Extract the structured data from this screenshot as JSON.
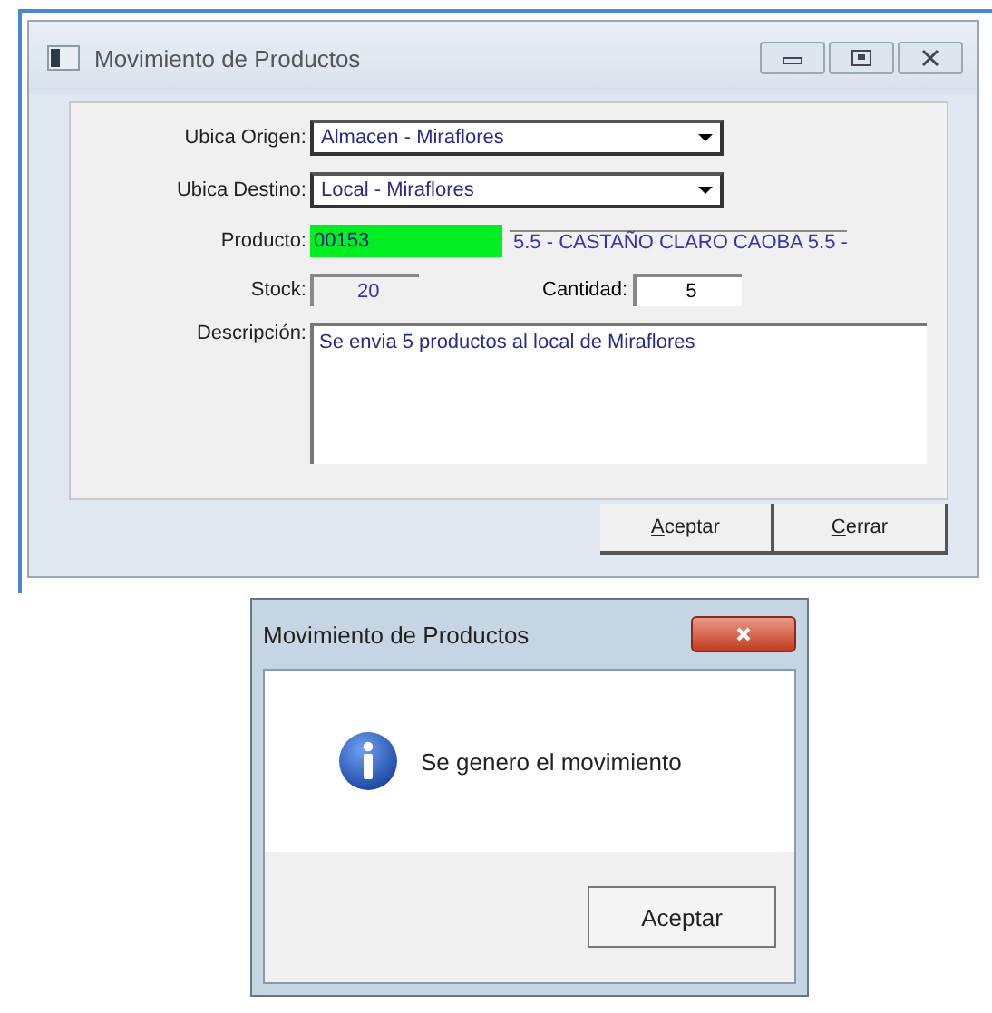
{
  "main_window": {
    "title": "Movimiento de Productos",
    "fields": [
      {
        "kind": "combo",
        "label": "Ubica Origen:",
        "value": "Almacen - Miraflores"
      },
      {
        "kind": "combo",
        "label": "Ubica Destino:",
        "value": "Local - Miraflores"
      },
      {
        "kind": "product",
        "label": "Producto:",
        "value": "00153",
        "description": "5.5 - CASTAÑO CLARO CAOBA 5.5 -"
      },
      {
        "kind": "pair",
        "label": "Stock:",
        "value": "20",
        "label_2": "Cantidad:",
        "value_2": "5"
      },
      {
        "kind": "memo",
        "label": "Descripción:",
        "value": "Se envia 5 productos al local de Miraflores"
      }
    ],
    "buttons": [
      {
        "label": "Aceptar"
      },
      {
        "label": "Cerrar"
      }
    ]
  },
  "dialog": {
    "title": "Movimiento de Productos",
    "message": "Se genero el movimiento",
    "button": "Aceptar"
  }
}
